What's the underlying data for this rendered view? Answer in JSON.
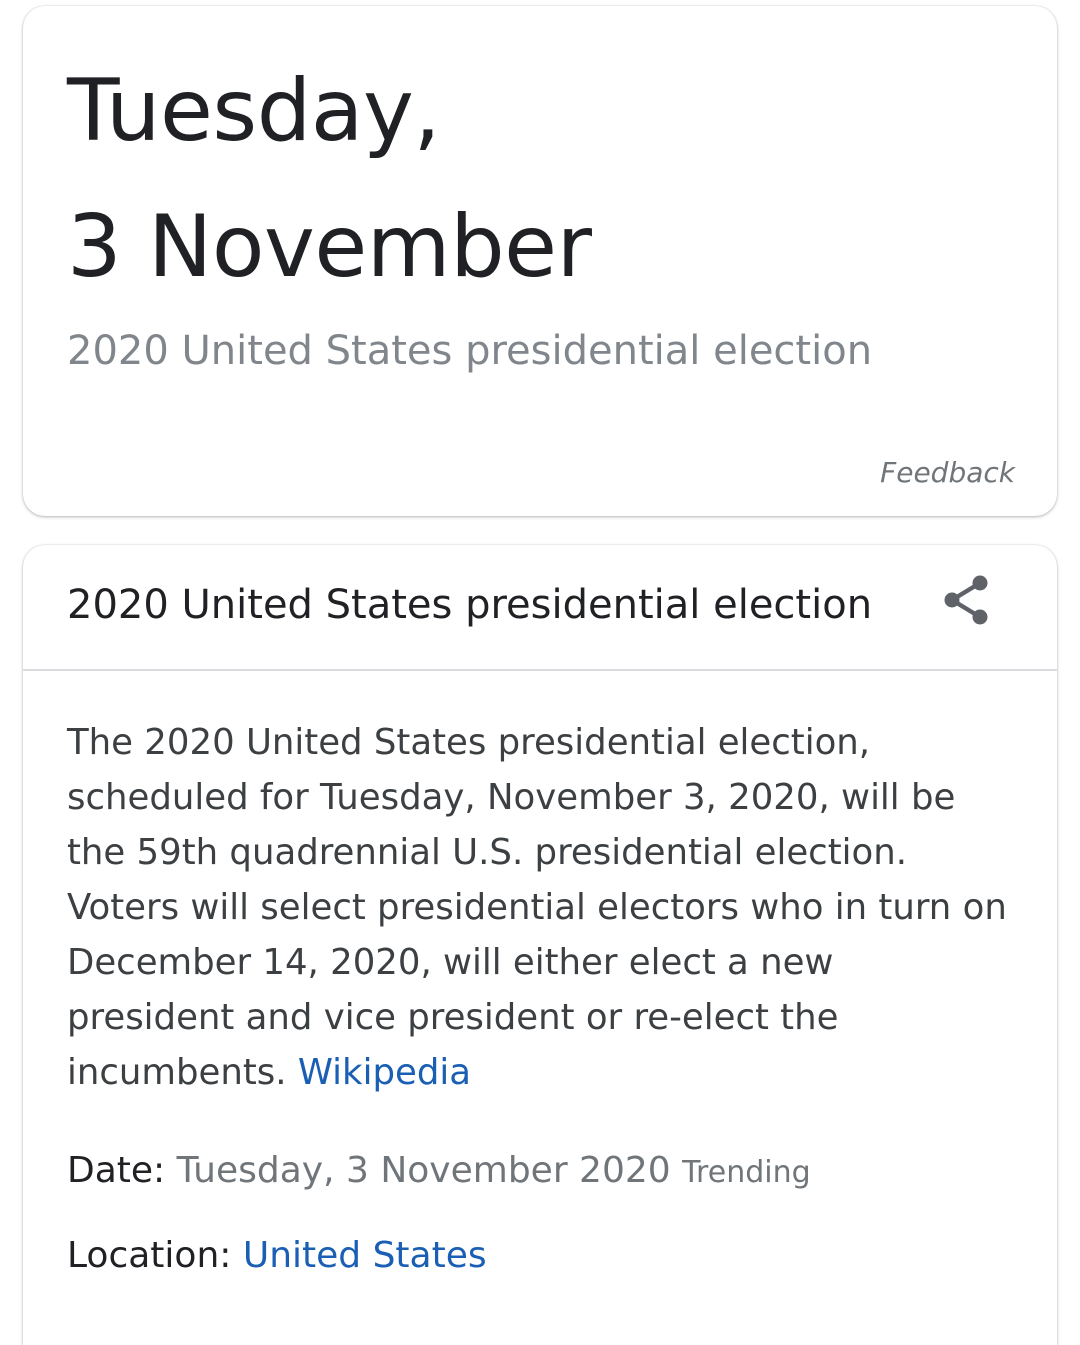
{
  "date_card": {
    "weekday_line": "Tuesday,",
    "date_line": "3 November",
    "subtitle": "2020 United States presidential election",
    "feedback_label": "Feedback"
  },
  "info_card": {
    "title": "2020 United States presidential election",
    "share_icon": "share-icon",
    "description": "The 2020 United States presidential election, scheduled for Tuesday, November 3, 2020, will be the 59th quadrennial U.S. presidential election. Voters will select presidential electors who in turn on December 14, 2020, will either elect a new president and vice president or re-elect the incumbents.",
    "source_link": "Wikipedia",
    "facts": {
      "date_label": "Date:",
      "date_value": "Tuesday, 3 November 2020",
      "trending_tag": "Trending",
      "location_label": "Location:",
      "location_value": "United States"
    }
  },
  "colors": {
    "link": "#1a5fb4",
    "primary_text": "#202124",
    "secondary_text": "#70757a",
    "divider": "#dadce0"
  }
}
